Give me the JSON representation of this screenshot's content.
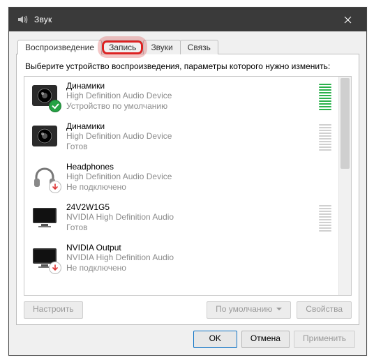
{
  "window": {
    "title": "Звук",
    "close_glyph": "✕"
  },
  "tabs": [
    {
      "label": "Воспроизведение",
      "active": true
    },
    {
      "label": "Запись",
      "active": false,
      "highlight": true
    },
    {
      "label": "Звуки",
      "active": false
    },
    {
      "label": "Связь",
      "active": false
    }
  ],
  "instruction": "Выберите устройство воспроизведения, параметры которого нужно изменить:",
  "devices": [
    {
      "icon": "speaker",
      "badge": "ok",
      "name": "Динамики",
      "driver": "High Definition Audio Device",
      "status": "Устройство по умолчанию",
      "meter": "green",
      "level": 10
    },
    {
      "icon": "speaker",
      "badge": null,
      "name": "Динамики",
      "driver": "High Definition Audio Device",
      "status": "Готов",
      "meter": "gray",
      "level": 0
    },
    {
      "icon": "headphones",
      "badge": "down",
      "name": "Headphones",
      "driver": "High Definition Audio Device",
      "status": "Не подключено",
      "meter": null,
      "level": 0
    },
    {
      "icon": "monitor",
      "badge": null,
      "name": "24V2W1G5",
      "driver": "NVIDIA High Definition Audio",
      "status": "Готов",
      "meter": "gray",
      "level": 0
    },
    {
      "icon": "monitor",
      "badge": "down",
      "name": "NVIDIA Output",
      "driver": "NVIDIA High Definition Audio",
      "status": "Не подключено",
      "meter": null,
      "level": 0
    }
  ],
  "panel_buttons": {
    "configure": "Настроить",
    "default": "По умолчанию",
    "properties": "Свойства"
  },
  "dialog_buttons": {
    "ok": "OK",
    "cancel": "Отмена",
    "apply": "Применить"
  }
}
